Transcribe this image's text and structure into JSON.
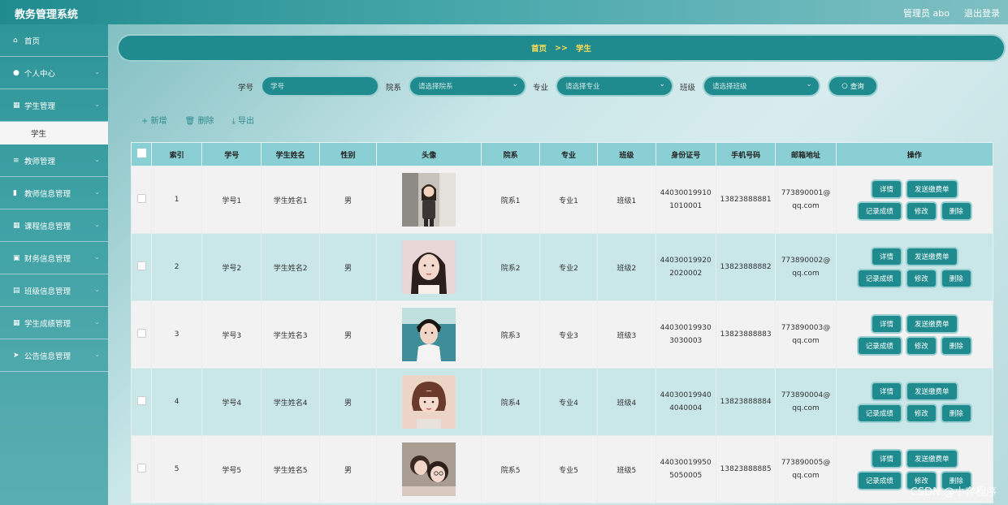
{
  "app": {
    "title": "教务管理系统",
    "user": "管理员 abo",
    "logout": "退出登录"
  },
  "sidebar": {
    "items": [
      {
        "label": "首页",
        "icon": "home-icon",
        "glyph": "⌂",
        "chevron": false
      },
      {
        "label": "个人中心",
        "icon": "user-icon",
        "glyph": "●",
        "chevron": true
      },
      {
        "label": "学生管理",
        "icon": "grid-icon",
        "glyph": "▦",
        "chevron": true
      },
      {
        "label": "教师管理",
        "icon": "list-icon",
        "glyph": "≡",
        "chevron": true
      },
      {
        "label": "教师信息管理",
        "icon": "bar-chart-icon",
        "glyph": "▮",
        "chevron": true
      },
      {
        "label": "课程信息管理",
        "icon": "grid-icon",
        "glyph": "▦",
        "chevron": true
      },
      {
        "label": "财务信息管理",
        "icon": "wallet-icon",
        "glyph": "▣",
        "chevron": true
      },
      {
        "label": "班级信息管理",
        "icon": "clipboard-icon",
        "glyph": "▤",
        "chevron": true
      },
      {
        "label": "学生成绩管理",
        "icon": "grid-icon",
        "glyph": "▦",
        "chevron": true
      },
      {
        "label": "公告信息管理",
        "icon": "send-icon",
        "glyph": "➤",
        "chevron": true
      }
    ],
    "sub_item": "学生"
  },
  "breadcrumb": {
    "home": "首页",
    "sep": ">>",
    "current": "学生"
  },
  "search": {
    "label_xuehao": "学号",
    "placeholder_xuehao": "学号",
    "label_yuanxi": "院系",
    "placeholder_yuanxi": "请选择院系",
    "label_zhuanye": "专业",
    "placeholder_zhuanye": "请选择专业",
    "label_banji": "班级",
    "placeholder_banji": "请选择班级",
    "button": "查询"
  },
  "toolbar": {
    "add": "+ 新增",
    "delete": "删除",
    "export": "导出"
  },
  "table": {
    "headers": [
      "索引",
      "学号",
      "学生姓名",
      "性别",
      "头像",
      "院系",
      "专业",
      "班级",
      "身份证号",
      "手机号码",
      "邮箱地址",
      "操作"
    ],
    "rows": [
      {
        "index": "1",
        "xuehao": "学号1",
        "name": "学生姓名1",
        "gender": "男",
        "dept": "院系1",
        "major": "专业1",
        "cls": "班级1",
        "id1": "44030019910",
        "id2": "1010001",
        "phone": "13823888881",
        "email1": "773890001@",
        "email2": "qq.com"
      },
      {
        "index": "2",
        "xuehao": "学号2",
        "name": "学生姓名2",
        "gender": "男",
        "dept": "院系2",
        "major": "专业2",
        "cls": "班级2",
        "id1": "44030019920",
        "id2": "2020002",
        "phone": "13823888882",
        "email1": "773890002@",
        "email2": "qq.com"
      },
      {
        "index": "3",
        "xuehao": "学号3",
        "name": "学生姓名3",
        "gender": "男",
        "dept": "院系3",
        "major": "专业3",
        "cls": "班级3",
        "id1": "44030019930",
        "id2": "3030003",
        "phone": "13823888883",
        "email1": "773890003@",
        "email2": "qq.com"
      },
      {
        "index": "4",
        "xuehao": "学号4",
        "name": "学生姓名4",
        "gender": "男",
        "dept": "院系4",
        "major": "专业4",
        "cls": "班级4",
        "id1": "44030019940",
        "id2": "4040004",
        "phone": "13823888884",
        "email1": "773890004@",
        "email2": "qq.com"
      },
      {
        "index": "5",
        "xuehao": "学号5",
        "name": "学生姓名5",
        "gender": "男",
        "dept": "院系5",
        "major": "专业5",
        "cls": "班级5",
        "id1": "44030019950",
        "id2": "5050005",
        "phone": "13823888885",
        "email1": "773890005@",
        "email2": "qq.com"
      }
    ],
    "actions": {
      "detail": "详情",
      "bill": "发送缴费单",
      "score": "记录成绩",
      "edit": "修改",
      "del": "删除"
    }
  },
  "watermark": "CSDN @小奔程序",
  "colors": {
    "primary": "#1f8b8e",
    "header": "#89cfd3",
    "breadcrumb_text": "#ffdd55"
  }
}
